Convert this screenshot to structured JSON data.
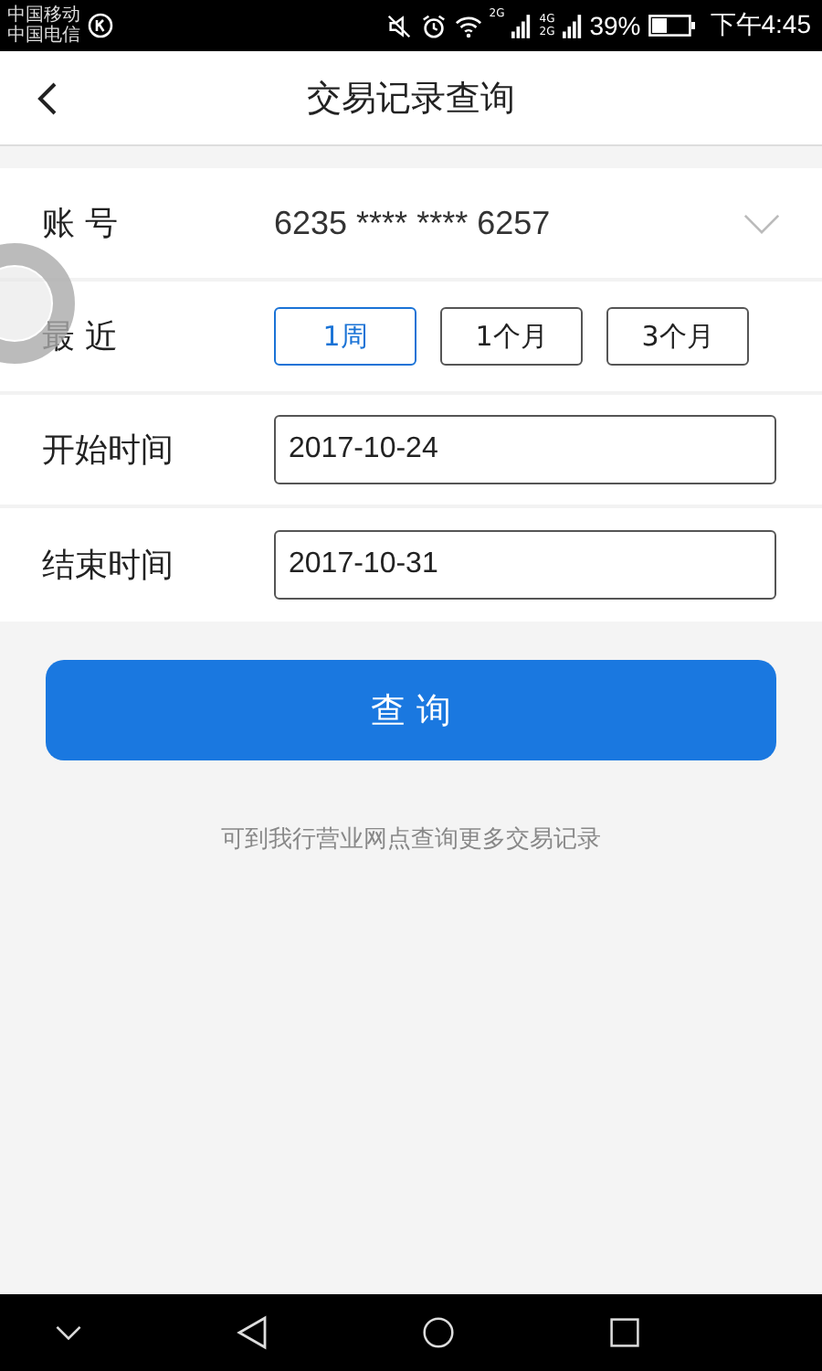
{
  "status_bar": {
    "carriers": [
      "中国移动",
      "中国电信"
    ],
    "network_labels": [
      "2G",
      "4G",
      "2G"
    ],
    "battery": "39%",
    "time": "下午4:45"
  },
  "header": {
    "title": "交易记录查询"
  },
  "account": {
    "label": "账 号",
    "value": "6235 **** **** 6257"
  },
  "recent": {
    "label": "最 近",
    "options": [
      {
        "label": "1周",
        "selected": true
      },
      {
        "label": "1个月",
        "selected": false
      },
      {
        "label": "3个月",
        "selected": false
      }
    ]
  },
  "start": {
    "label": "开始时间",
    "value": "2017-10-24"
  },
  "end": {
    "label": "结束时间",
    "value": "2017-10-31"
  },
  "query_button": "查 询",
  "note": "可到我行营业网点查询更多交易记录"
}
